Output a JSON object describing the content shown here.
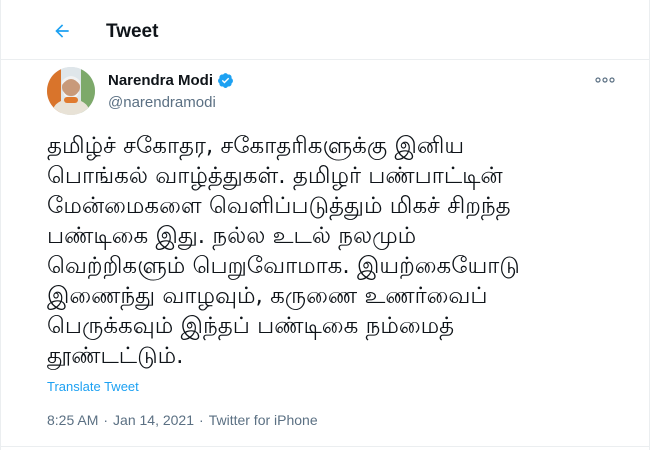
{
  "header": {
    "title": "Tweet",
    "back_icon": "arrow-left-icon"
  },
  "user": {
    "name": "Narendra Modi",
    "handle": "@narendramodi",
    "verified_icon": "verified-badge-icon"
  },
  "more_icon": "more-horizontal-icon",
  "tweet": {
    "text": "தமிழ்ச் சகோதர, சகோதரிகளுக்கு இனிய\nபொங்கல் வாழ்த்துகள். தமிழர் பண்பாட்டின்\nமேன்மைகளை வெளிப்படுத்தும் மிகச் சிறந்த\nபண்டிகை இது. நல்ல உடல் நலமும்\nவெற்றிகளும் பெறுவோமாக. இயற்கையோடு\nஇணைந்து வாழவும், கருணை உணர்வைப்\nபெருக்கவும் இந்தப் பண்டிகை நம்மைத்\nதூண்டட்டும்.",
    "translate_label": "Translate Tweet",
    "time": "8:25 AM",
    "date": "Jan 14, 2021",
    "source": "Twitter for iPhone",
    "separator": "·"
  },
  "colors": {
    "accent": "#1da1f2",
    "secondary_text": "#5b7083",
    "primary_text": "#0f1419"
  }
}
